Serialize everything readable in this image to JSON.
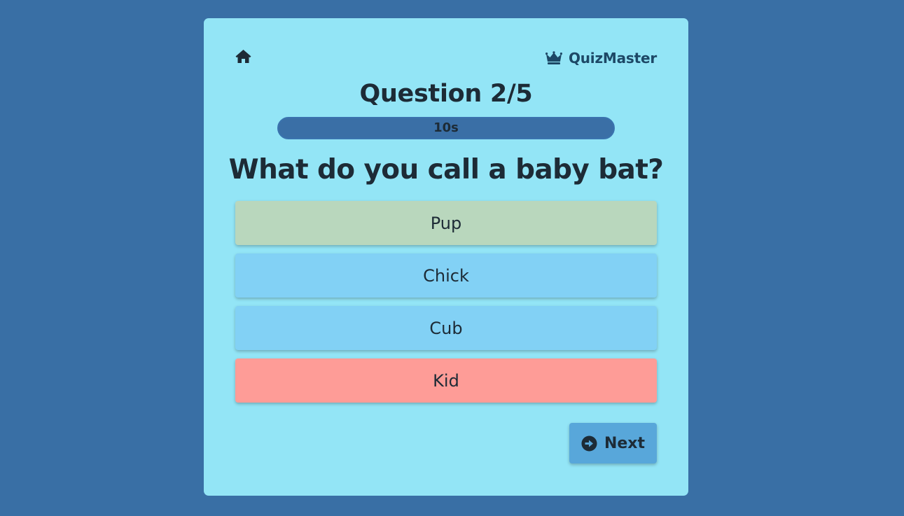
{
  "app": {
    "brand_name": "QuizMaster",
    "brand_icon": "crown-icon",
    "home_icon": "home-icon"
  },
  "quiz": {
    "question_counter": "Question 2/5",
    "timer_label": "10s",
    "question": "What do you call a baby bat?",
    "answers": [
      {
        "label": "Pup",
        "state": "correct",
        "color": "#b9d7bd"
      },
      {
        "label": "Chick",
        "state": "neutral",
        "color": "#82d1f5"
      },
      {
        "label": "Cub",
        "state": "neutral",
        "color": "#82d1f5"
      },
      {
        "label": "Kid",
        "state": "incorrect",
        "color": "#fe9c97"
      }
    ],
    "next_label": "Next",
    "next_icon": "arrow-circle-right-icon"
  },
  "colors": {
    "background": "#396fa5",
    "card": "#93e5f6",
    "timer_track": "#3a6fa6",
    "next_button": "#58a7da",
    "text": "#1d2b36"
  }
}
